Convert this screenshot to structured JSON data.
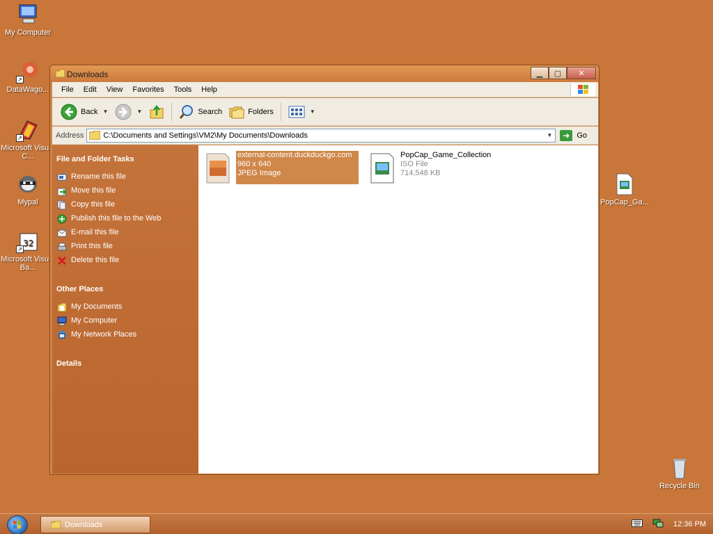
{
  "desktop": {
    "icons": [
      {
        "label": "My Computer"
      },
      {
        "label": "DataWago..."
      },
      {
        "label": "Microsoft Visual C..."
      },
      {
        "label": "Mypal"
      },
      {
        "label": "Microsoft Visual Ba..."
      },
      {
        "label": "PopCap_Ga..."
      },
      {
        "label": "Recycle Bin"
      }
    ]
  },
  "window": {
    "title": "Downloads",
    "menu": [
      "File",
      "Edit",
      "View",
      "Favorites",
      "Tools",
      "Help"
    ],
    "toolbar": {
      "back": "Back",
      "search": "Search",
      "folders": "Folders"
    },
    "address": {
      "label": "Address",
      "value": "C:\\Documents and Settings\\VM2\\My Documents\\Downloads",
      "go": "Go"
    },
    "tasks": {
      "file_folder_title": "File and Folder Tasks",
      "items": [
        "Rename this file",
        "Move this file",
        "Copy this file",
        "Publish this file to the Web",
        "E-mail this file",
        "Print this file",
        "Delete this file"
      ],
      "other_places_title": "Other Places",
      "places": [
        "My Documents",
        "My Computer",
        "My Network Places"
      ],
      "details_title": "Details"
    },
    "files": [
      {
        "name": "external-content.duckduckgo.com",
        "line2": "960 x 640",
        "line3": "JPEG Image",
        "selected": true
      },
      {
        "name": "PopCap_Game_Collection",
        "line2": "ISO File",
        "line3": "714,548 KB",
        "selected": false
      }
    ]
  },
  "taskbar": {
    "window_button": "Downloads",
    "clock": "12:36 PM"
  }
}
